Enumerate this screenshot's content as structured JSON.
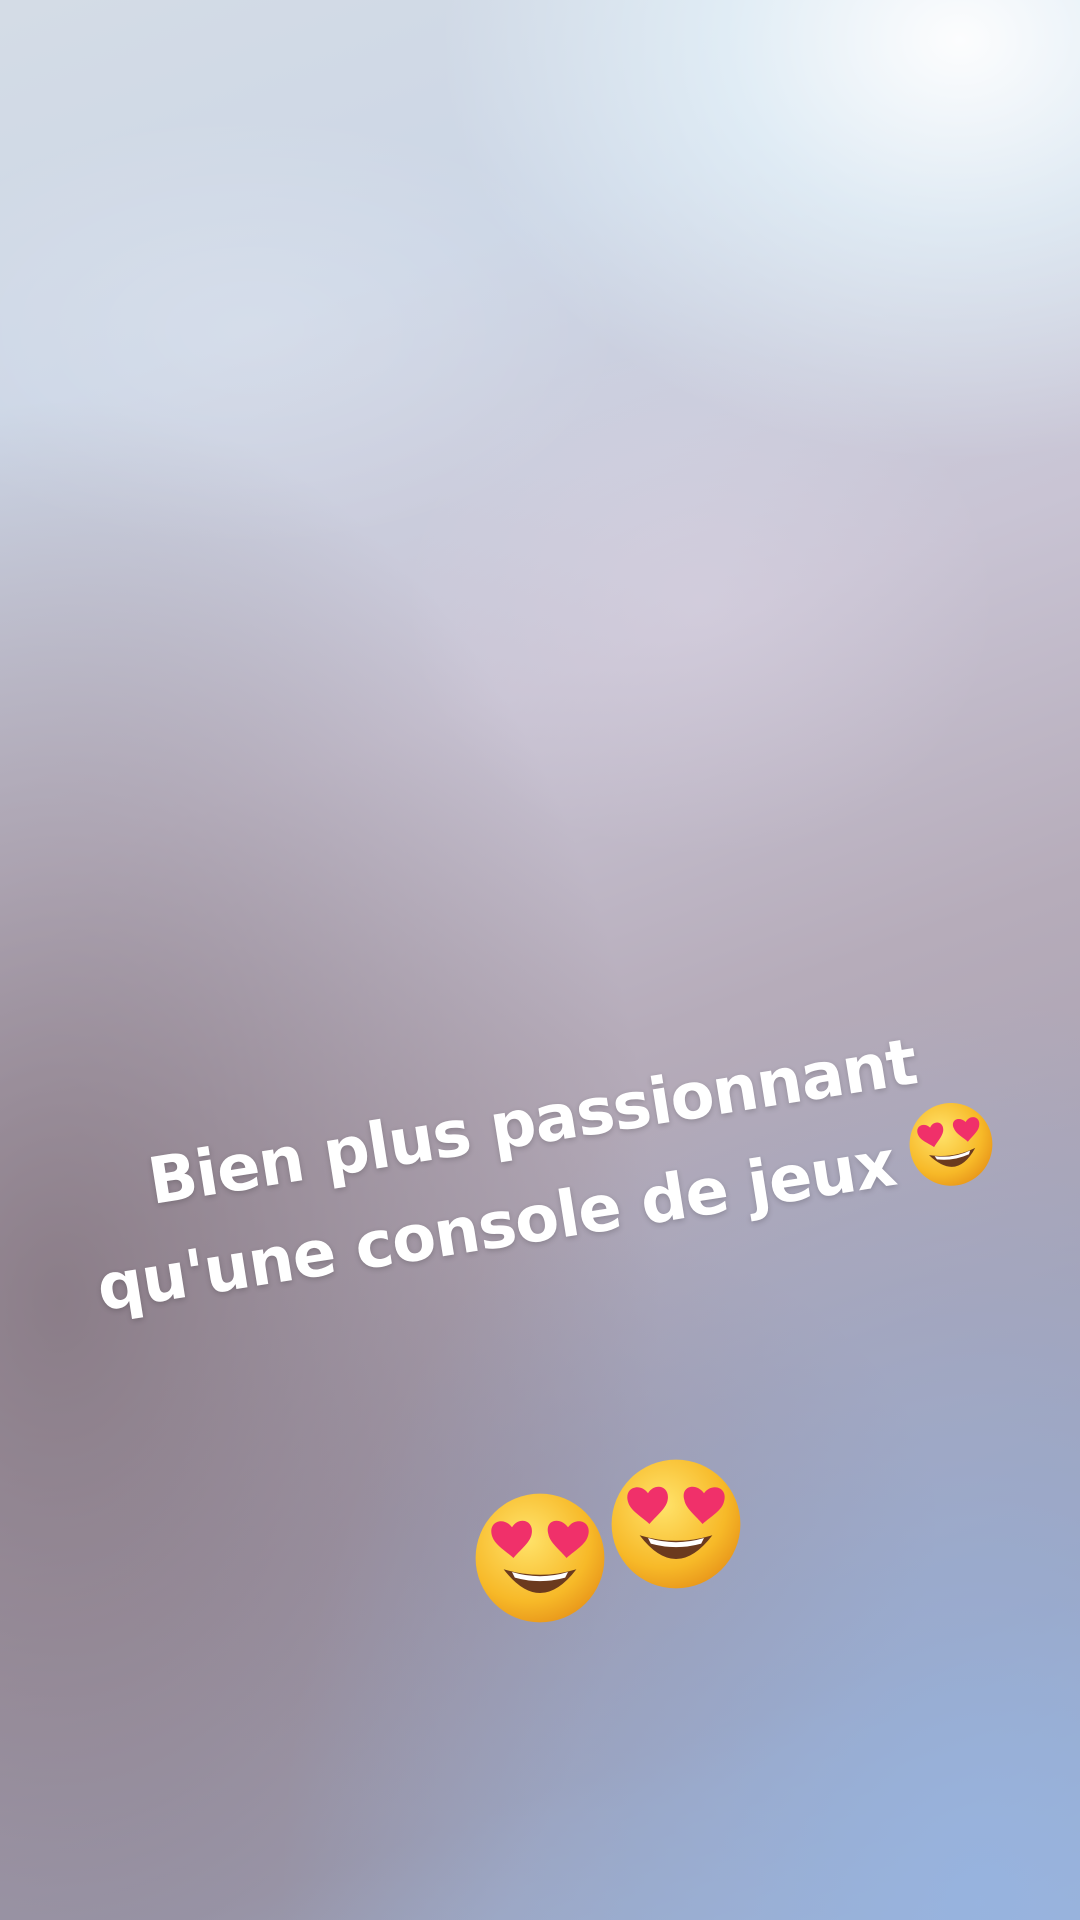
{
  "caption": {
    "line1": "Bien plus passionnant",
    "line2": "qu'une console de jeux"
  },
  "stickers": [
    {
      "icon": "heart-eyes-emoji-icon"
    },
    {
      "icon": "heart-eyes-emoji-icon"
    },
    {
      "icon": "heart-eyes-emoji-icon"
    }
  ],
  "colors": {
    "text": "#ffffff",
    "emoji_face": "#f9c43a",
    "emoji_heart": "#f0306a"
  }
}
